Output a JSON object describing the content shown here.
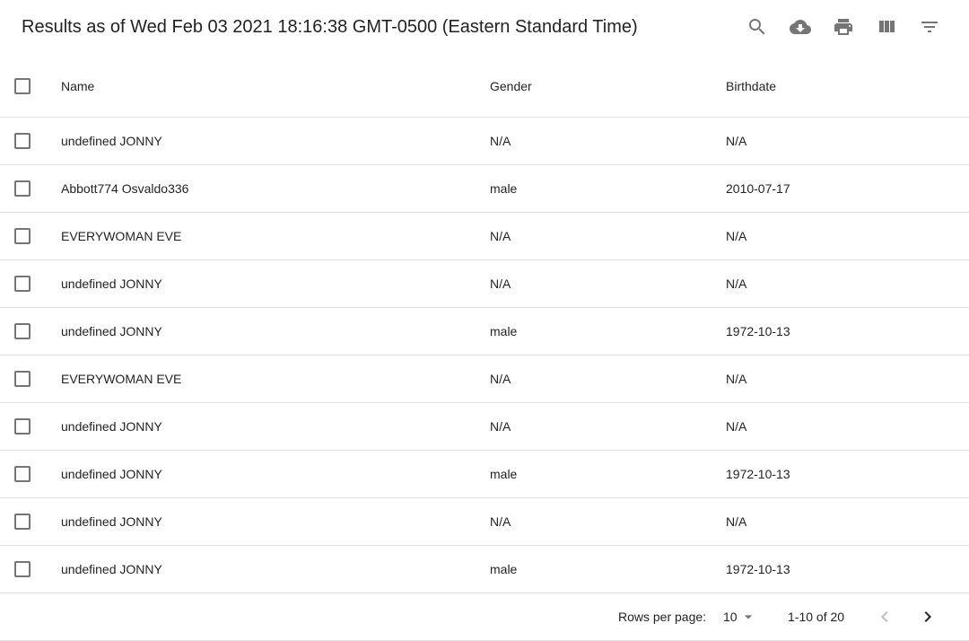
{
  "toolbar": {
    "title": "Results as of Wed Feb 03 2021 18:16:38 GMT-0500 (Eastern Standard Time)",
    "icons": [
      "search-icon",
      "download-icon",
      "print-icon",
      "view-columns-icon",
      "filter-icon"
    ]
  },
  "table": {
    "columns": {
      "name": "Name",
      "gender": "Gender",
      "birthdate": "Birthdate"
    },
    "rows": [
      {
        "name": "undefined JONNY",
        "gender": "N/A",
        "birthdate": "N/A"
      },
      {
        "name": "Abbott774 Osvaldo336",
        "gender": "male",
        "birthdate": "2010-07-17"
      },
      {
        "name": "EVERYWOMAN EVE",
        "gender": "N/A",
        "birthdate": "N/A"
      },
      {
        "name": "undefined JONNY",
        "gender": "N/A",
        "birthdate": "N/A"
      },
      {
        "name": "undefined JONNY",
        "gender": "male",
        "birthdate": "1972-10-13"
      },
      {
        "name": "EVERYWOMAN EVE",
        "gender": "N/A",
        "birthdate": "N/A"
      },
      {
        "name": "undefined JONNY",
        "gender": "N/A",
        "birthdate": "N/A"
      },
      {
        "name": "undefined JONNY",
        "gender": "male",
        "birthdate": "1972-10-13"
      },
      {
        "name": "undefined JONNY",
        "gender": "N/A",
        "birthdate": "N/A"
      },
      {
        "name": "undefined JONNY",
        "gender": "male",
        "birthdate": "1972-10-13"
      }
    ]
  },
  "pagination": {
    "rows_per_page_label": "Rows per page:",
    "rows_per_page_value": "10",
    "range_text": "1-10 of 20"
  }
}
